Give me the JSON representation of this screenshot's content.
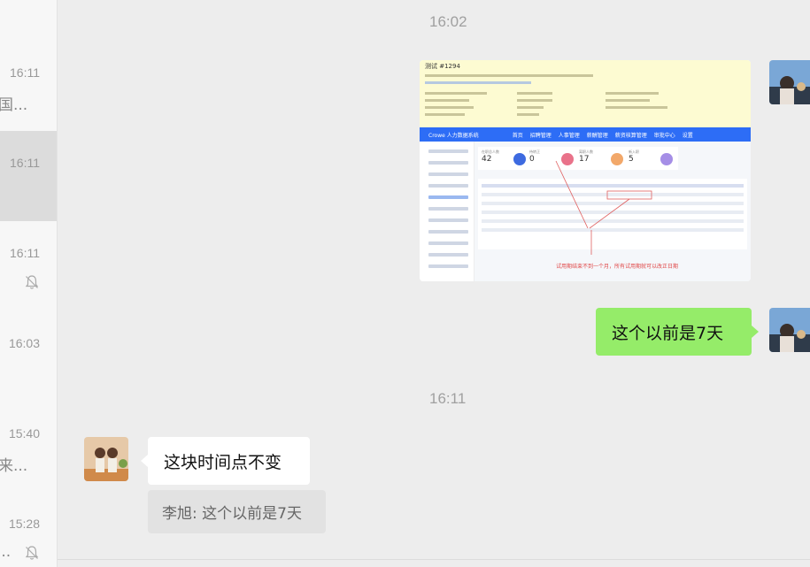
{
  "sidebar": {
    "conversations": [
      {
        "time": "16:11",
        "snippet": "国..."
      },
      {
        "time": "16:11",
        "snippet": ""
      },
      {
        "time": "16:11",
        "snippet": "",
        "muted": true
      },
      {
        "time": "16:03",
        "snippet": ""
      },
      {
        "time": "15:40",
        "snippet": "来..."
      },
      {
        "time": "15:28",
        "snippet": "...",
        "muted": true
      }
    ],
    "active_index": 1
  },
  "chat": {
    "timestamps": [
      "16:02",
      "16:11"
    ],
    "image_message": {
      "title": "测试 #1294",
      "nav_brand": "Crowe 人力数据系统",
      "nav_items": [
        "首页",
        "招聘管理",
        "人事管理",
        "薪酬管理",
        "薪资核算管理",
        "审批中心",
        "设置"
      ],
      "cards": [
        {
          "label": "在职总人数",
          "value": "42"
        },
        {
          "label": "待转正",
          "value": "0"
        },
        {
          "label": "离职人数",
          "value": "17"
        },
        {
          "label": "新入职",
          "value": "5"
        }
      ],
      "note": "试用期结束不到一个月，所有试用期就可以改正日期"
    },
    "messages": [
      {
        "side": "right",
        "text": "这个以前是7天"
      },
      {
        "side": "left",
        "text": "这块时间点不变",
        "quote": "李旭: 这个以前是7天"
      }
    ]
  },
  "colors": {
    "outgoing": "#95ec69",
    "incoming": "#ffffff",
    "background": "#ededed",
    "quote": "#e2e2e2"
  }
}
